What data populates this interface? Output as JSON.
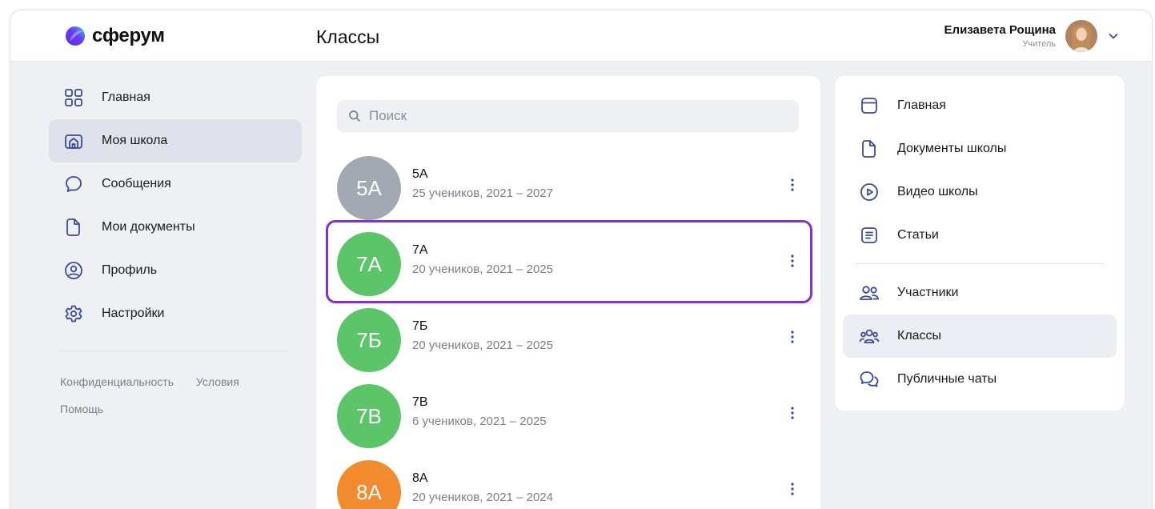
{
  "app": {
    "logo_text": "сферум",
    "page_title": "Классы"
  },
  "user": {
    "name": "Елизавета Рощина",
    "role": "Учитель"
  },
  "left_nav": {
    "items": [
      {
        "label": "Главная",
        "icon": "grid-icon"
      },
      {
        "label": "Моя школа",
        "icon": "school-icon",
        "active": true
      },
      {
        "label": "Сообщения",
        "icon": "chat-bubble-icon"
      },
      {
        "label": "Мои документы",
        "icon": "document-icon"
      },
      {
        "label": "Профиль",
        "icon": "profile-icon"
      },
      {
        "label": "Настройки",
        "icon": "gear-icon"
      }
    ],
    "footer": {
      "privacy": "Конфиденциальность",
      "terms": "Условия",
      "help": "Помощь"
    }
  },
  "search": {
    "placeholder": "Поиск"
  },
  "classes": [
    {
      "avatar": "5А",
      "name": "5А",
      "meta": "25 учеников, 2021 – 2027",
      "color": "#a3a9b3"
    },
    {
      "avatar": "7А",
      "name": "7А",
      "meta": "20 учеников, 2021 – 2025",
      "color": "#5cc469",
      "highlighted": true
    },
    {
      "avatar": "7Б",
      "name": "7Б",
      "meta": "20 учеников, 2021 – 2025",
      "color": "#5cc469"
    },
    {
      "avatar": "7В",
      "name": "7В",
      "meta": "6 учеников, 2021 – 2025",
      "color": "#5cc469"
    },
    {
      "avatar": "8А",
      "name": "8А",
      "meta": "20 учеников, 2021 – 2024",
      "color": "#f28a2e"
    }
  ],
  "right_nav": {
    "items": [
      {
        "label": "Главная",
        "icon": "window-icon"
      },
      {
        "label": "Документы школы",
        "icon": "document-icon"
      },
      {
        "label": "Видео школы",
        "icon": "play-icon"
      },
      {
        "label": "Статьи",
        "icon": "article-icon"
      },
      {
        "label": "Участники",
        "icon": "users-icon"
      },
      {
        "label": "Классы",
        "icon": "group-icon",
        "active": true
      },
      {
        "label": "Публичные чаты",
        "icon": "chats-icon"
      }
    ]
  },
  "colors": {
    "accent_icon": "#3a4a9a",
    "highlight_border": "#8a2ec8"
  }
}
